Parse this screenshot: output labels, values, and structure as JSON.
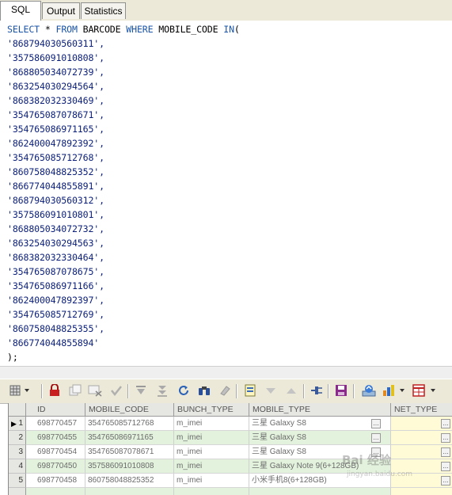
{
  "tabs": [
    {
      "label": "SQL",
      "active": true
    },
    {
      "label": "Output",
      "active": false
    },
    {
      "label": "Statistics",
      "active": false
    }
  ],
  "sql": {
    "header": {
      "kw1": "SELECT",
      "star": " * ",
      "kw2": "FROM",
      "table": " BARCODE ",
      "kw3": "WHERE",
      "col": " MOBILE_CODE ",
      "kw4": "IN",
      "paren": "("
    },
    "values": [
      "'868794030560311',",
      "'357586091010808',",
      "'868805034072739',",
      "'863254030294564',",
      "'868382032330469',",
      "'354765087078671',",
      "'354765086971165',",
      "'862400047892392',",
      "'354765085712768',",
      "'860758048825352',",
      "'866774044855891',",
      "'868794030560312',",
      "'357586091010801',",
      "'868805034072732',",
      "'863254030294563',",
      "'868382032330464',",
      "'354765087078675',",
      "'354765086971166',",
      "'862400047892397',",
      "'354765085712769',",
      "'860758048825355',",
      "'866774044855894'"
    ],
    "closing": ");"
  },
  "toolbar": {
    "icons": [
      "grid-options-icon",
      "lock-icon",
      "copy-icon",
      "paste-icon",
      "check-icon",
      "move-down-icon",
      "move-last-icon",
      "refresh-icon",
      "find-icon",
      "clear-icon",
      "export-icon",
      "filter-down-icon",
      "filter-up-icon",
      "link-icon",
      "save-icon",
      "upload-icon",
      "chart-icon",
      "table-icon"
    ]
  },
  "grid": {
    "columns": [
      "ID",
      "MOBILE_CODE",
      "BUNCH_TYPE",
      "MOBILE_TYPE",
      "NET_TYPE"
    ],
    "rows": [
      {
        "num": "1",
        "id": "698770457",
        "mobile_code": "354765085712768",
        "bunch_type": "m_imei",
        "mobile_type": "三星 Galaxy S8",
        "net_type": ""
      },
      {
        "num": "2",
        "id": "698770455",
        "mobile_code": "354765086971165",
        "bunch_type": "m_imei",
        "mobile_type": "三星 Galaxy S8",
        "net_type": ""
      },
      {
        "num": "3",
        "id": "698770454",
        "mobile_code": "354765087078671",
        "bunch_type": "m_imei",
        "mobile_type": "三星 Galaxy S8",
        "net_type": ""
      },
      {
        "num": "4",
        "id": "698770450",
        "mobile_code": "357586091010808",
        "bunch_type": "m_imei",
        "mobile_type": "三星 Galaxy Note 9(6+128GB)",
        "net_type": ""
      },
      {
        "num": "5",
        "id": "698770458",
        "mobile_code": "860758048825352",
        "bunch_type": "m_imei",
        "mobile_type": "小米手机8(6+128GB)",
        "net_type": ""
      }
    ]
  },
  "watermark": {
    "text": "Bai 经验",
    "sub": "jingyan.baidu.com"
  }
}
